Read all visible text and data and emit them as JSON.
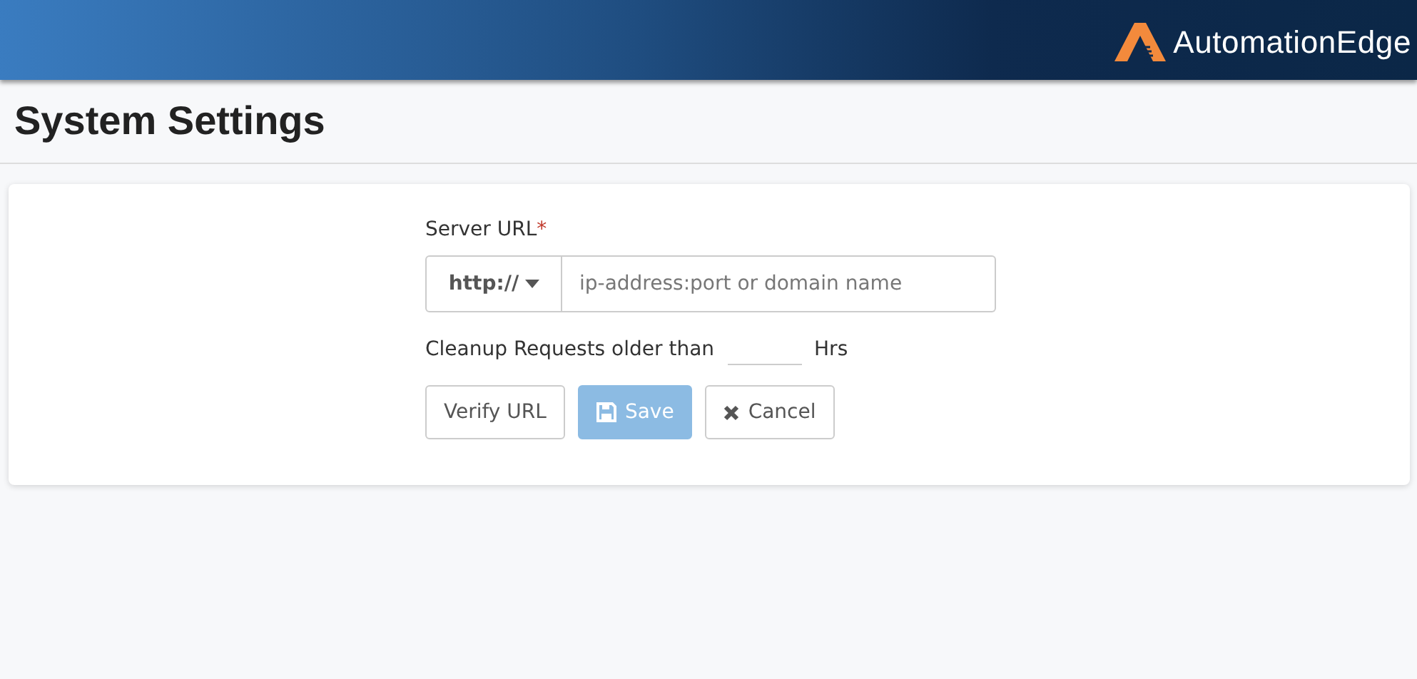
{
  "header": {
    "logo_text": "AutomationEdge"
  },
  "page_title": "System Settings",
  "form": {
    "server_url": {
      "label": "Server URL",
      "required_mark": "*",
      "protocol": "http://",
      "placeholder": "ip-address:port or domain name"
    },
    "cleanup": {
      "label": "Cleanup Requests older than",
      "unit": "Hrs"
    },
    "buttons": [
      {
        "label": "Verify URL",
        "kind": "plain",
        "disabled": false
      },
      {
        "label": "Save",
        "kind": "save",
        "disabled": true
      },
      {
        "label": "Cancel",
        "kind": "cancel",
        "disabled": false
      }
    ]
  }
}
